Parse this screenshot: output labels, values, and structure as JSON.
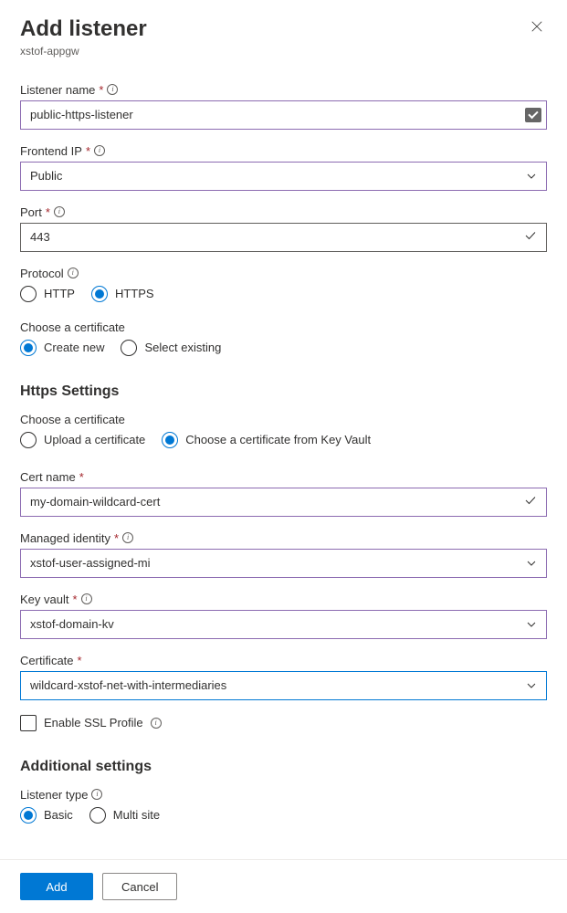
{
  "header": {
    "title": "Add listener",
    "subtitle": "xstof-appgw"
  },
  "fields": {
    "listener_name": {
      "label": "Listener name",
      "value": "public-https-listener"
    },
    "frontend_ip": {
      "label": "Frontend IP",
      "value": "Public"
    },
    "port": {
      "label": "Port",
      "value": "443"
    },
    "protocol": {
      "label": "Protocol",
      "options": {
        "http": "HTTP",
        "https": "HTTPS"
      }
    },
    "choose_cert_top": {
      "label": "Choose a certificate",
      "options": {
        "create_new": "Create new",
        "select_existing": "Select existing"
      }
    }
  },
  "https_settings": {
    "title": "Https Settings",
    "choose_cert": {
      "label": "Choose a certificate",
      "options": {
        "upload": "Upload a certificate",
        "keyvault": "Choose a certificate from Key Vault"
      }
    },
    "cert_name": {
      "label": "Cert name",
      "value": "my-domain-wildcard-cert"
    },
    "managed_identity": {
      "label": "Managed identity",
      "value": "xstof-user-assigned-mi"
    },
    "key_vault": {
      "label": "Key vault",
      "value": "xstof-domain-kv"
    },
    "certificate": {
      "label": "Certificate",
      "value": "wildcard-xstof-net-with-intermediaries"
    },
    "enable_ssl": {
      "label": "Enable SSL Profile"
    }
  },
  "additional": {
    "title": "Additional settings",
    "listener_type": {
      "label": "Listener type",
      "options": {
        "basic": "Basic",
        "multi": "Multi site"
      }
    }
  },
  "footer": {
    "add": "Add",
    "cancel": "Cancel"
  }
}
